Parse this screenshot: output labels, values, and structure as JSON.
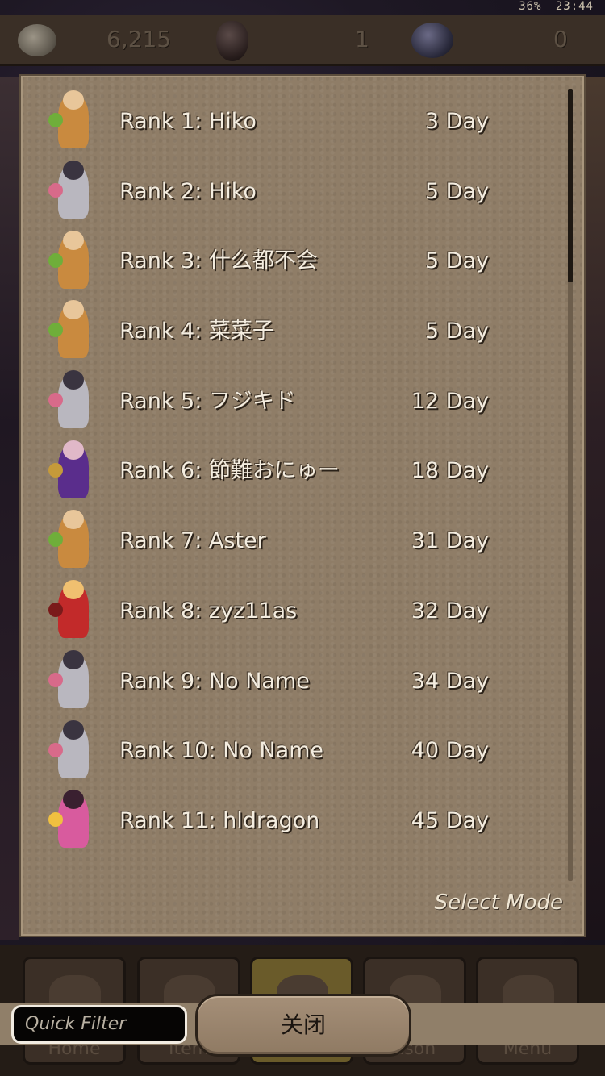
{
  "status_bar": {
    "battery": "36%",
    "time": "23:44"
  },
  "currency": [
    {
      "icon": "coin-icon",
      "value": "6,215"
    },
    {
      "icon": "gem-icon",
      "value": "1"
    },
    {
      "icon": "orb-icon",
      "value": "0"
    }
  ],
  "ranking": {
    "rows": [
      {
        "label": "Rank 1: Hiko",
        "days": "3 Day",
        "avatar": "monk-warrior"
      },
      {
        "label": "Rank 2: Hiko",
        "days": "5 Day",
        "avatar": "grey-knight"
      },
      {
        "label": "Rank 3: 什么都不会",
        "days": "5 Day",
        "avatar": "monk-warrior"
      },
      {
        "label": "Rank 4: 菜菜子",
        "days": "5 Day",
        "avatar": "monk-warrior"
      },
      {
        "label": "Rank 5: フジキド",
        "days": "12 Day",
        "avatar": "grey-knight"
      },
      {
        "label": "Rank 6: 節難おにゅー",
        "days": "18 Day",
        "avatar": "purple-mage"
      },
      {
        "label": "Rank 7: Aster",
        "days": "31 Day",
        "avatar": "monk-warrior"
      },
      {
        "label": "Rank 8: zyz11as",
        "days": "32 Day",
        "avatar": "red-swordsman"
      },
      {
        "label": "Rank 9: No Name",
        "days": "34 Day",
        "avatar": "grey-knight"
      },
      {
        "label": "Rank 10: No Name",
        "days": "40 Day",
        "avatar": "grey-knight"
      },
      {
        "label": "Rank 11: hldragon",
        "days": "45 Day",
        "avatar": "pink-mage"
      }
    ],
    "select_mode_label": "Select Mode"
  },
  "bottom_menu": {
    "items": [
      {
        "label": "Home"
      },
      {
        "label": "Item"
      },
      {
        "label": ""
      },
      {
        "label": "ason"
      },
      {
        "label": "Menu"
      }
    ]
  },
  "quick_filter": {
    "placeholder": "Quick Filter"
  },
  "close_button": {
    "label": "关闭"
  },
  "colors": {
    "panel_bg": "#8f7d67",
    "text": "#f4ede0",
    "avatar_monk": "#c98a3f",
    "avatar_grey": "#b9b7bf",
    "avatar_purple": "#5a2d8c",
    "avatar_red": "#c22a2a",
    "avatar_pink": "#d85b9e"
  }
}
